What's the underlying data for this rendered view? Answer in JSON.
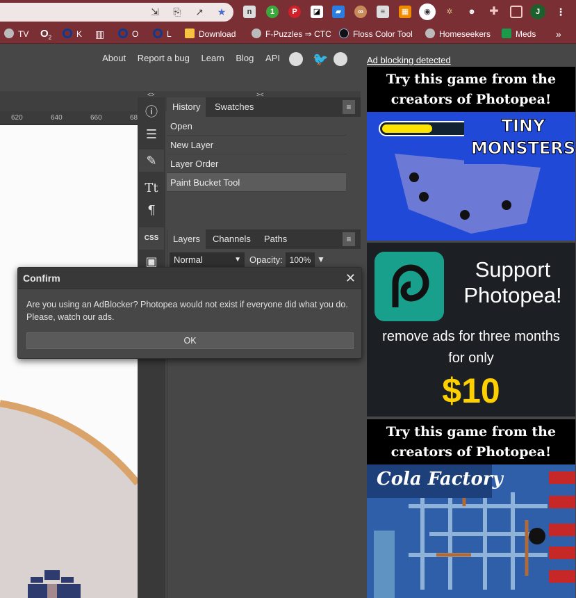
{
  "browser": {
    "toolbar_icons": [
      "share-icon",
      "install-icon",
      "share-page-icon",
      "star-icon"
    ],
    "extensions": [
      "n-ext",
      "green-ext",
      "pinterest-ext",
      "ext-notion",
      "ext-blue",
      "ext-eyes",
      "ext-list",
      "ext-orange",
      "camera-ext",
      "ext-bug",
      "ext-cat",
      "puzzle-icon",
      "sidebar-icon"
    ],
    "profile_initial": "J",
    "bookmarks": [
      "TV",
      "K",
      "O",
      "L",
      "Download",
      "F-Puzzles ⇒ CTC",
      "Floss Color Tool",
      "Homeseekers",
      "Meds"
    ],
    "bookmark_o2": "O",
    "bookmark_o2_sub": "2",
    "more": "»"
  },
  "photopea": {
    "top_links": [
      "About",
      "Report a bug",
      "Learn",
      "Blog",
      "API"
    ],
    "ruler_ticks": [
      "620",
      "640",
      "660",
      "68"
    ],
    "tools": [
      "info-icon",
      "adjust-icon",
      "brush-icon",
      "text-icon",
      "paragraph-icon",
      "css-icon",
      "image-icon"
    ],
    "css_label": "CSS",
    "history_tabs": [
      "History",
      "Swatches"
    ],
    "history_items": [
      "Open",
      "New Layer",
      "Layer Order",
      "Paint Bucket Tool"
    ],
    "layer_tabs": [
      "Layers",
      "Channels",
      "Paths"
    ],
    "blend_mode": "Normal",
    "opacity_label": "Opacity:",
    "opacity_value": "100%",
    "collapse_left": "<>",
    "collapse_right": "><"
  },
  "ads": {
    "notice": "Ad blocking detected",
    "ad1_title": "Try this game from the creators of Photopea!",
    "ad1_game": "TINY MONSTERS",
    "ad2_line1": "Support",
    "ad2_line2": "Photopea!",
    "ad2_line3": "remove ads for three months for only",
    "ad2_price": "$10",
    "ad3_title": "Try this game from the creators of Photopea!",
    "ad3_game": "Cola Factory"
  },
  "modal": {
    "title": "Confirm",
    "message": "Are you using an AdBlocker? Photopea would not exist if everyone did what you do. Please, watch our ads.",
    "ok": "OK",
    "close": "✕"
  }
}
